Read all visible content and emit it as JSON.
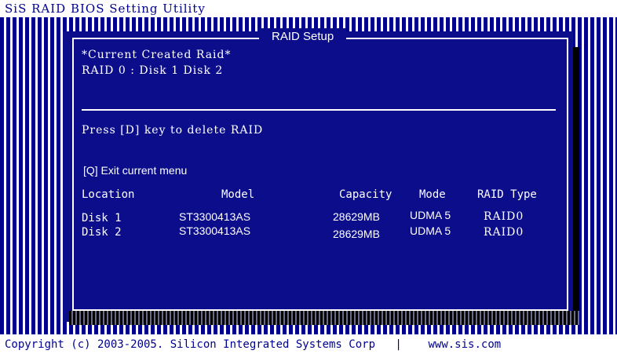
{
  "app": {
    "title": "SiS RAID BIOS Setting Utility"
  },
  "panel": {
    "title": "RAID Setup",
    "current_label": "*Current Created Raid*",
    "current_value": "RAID 0 : Disk 1   Disk 2",
    "delete_hint": "Press [D] key to delete RAID",
    "exit_hint": "[Q]  Exit current menu"
  },
  "table": {
    "headers": [
      "Location",
      "Model",
      "Capacity",
      "Mode",
      "RAID Type"
    ],
    "rows": [
      [
        "Disk 1",
        "ST3300413AS",
        "28629MB",
        "UDMA 5",
        "RAID0"
      ],
      [
        "Disk 2",
        "ST3300413AS",
        "28629MB",
        "UDMA 5",
        "RAID0"
      ]
    ]
  },
  "footer": {
    "copyright": "Copyright (c) 2003-2005. Silicon Integrated Systems Corp",
    "separator": "|",
    "url": "www.sis.com"
  },
  "colors": {
    "panel": "#0b0d8a",
    "stripe": "#00008f",
    "text": "#ffffff"
  }
}
